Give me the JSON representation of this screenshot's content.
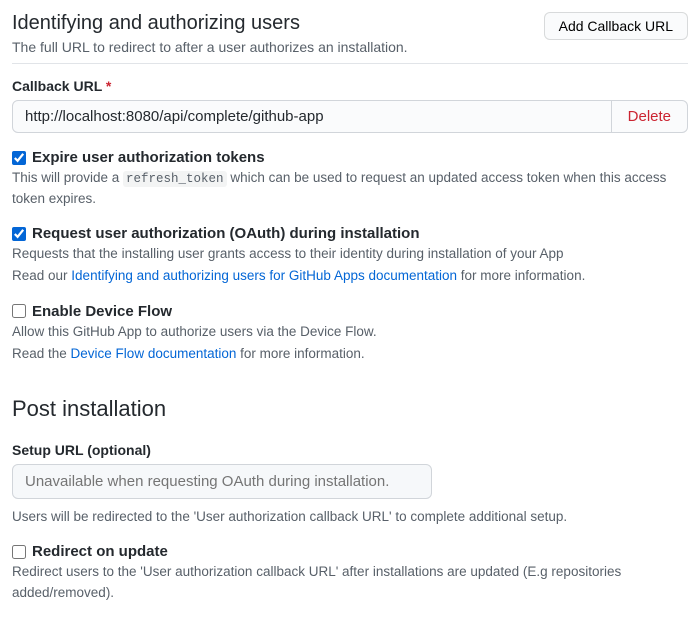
{
  "section1": {
    "title": "Identifying and authorizing users",
    "subtitle": "The full URL to redirect to after a user authorizes an installation.",
    "addBtn": "Add Callback URL"
  },
  "callback": {
    "label": "Callback URL",
    "required": "*",
    "value": "http://localhost:8080/api/complete/github-app",
    "deleteLabel": "Delete"
  },
  "expire": {
    "label": "Expire user authorization tokens",
    "help_pre": "This will provide a ",
    "help_code": "refresh_token",
    "help_post": " which can be used to request an updated access token when this access token expires."
  },
  "oauth": {
    "label": "Request user authorization (OAuth) during installation",
    "help1": "Requests that the installing user grants access to their identity during installation of your App",
    "help2_pre": "Read our ",
    "help2_link": "Identifying and authorizing users for GitHub Apps documentation",
    "help2_post": " for more information."
  },
  "device": {
    "label": "Enable Device Flow",
    "help1": "Allow this GitHub App to authorize users via the Device Flow.",
    "help2_pre": "Read the ",
    "help2_link": "Device Flow documentation",
    "help2_post": " for more information."
  },
  "post": {
    "title": "Post installation"
  },
  "setup": {
    "label": "Setup URL (optional)",
    "placeholder": "Unavailable when requesting OAuth during installation.",
    "help": "Users will be redirected to the 'User authorization callback URL' to complete additional setup."
  },
  "redirect": {
    "label": "Redirect on update",
    "help": "Redirect users to the 'User authorization callback URL' after installations are updated (E.g repositories added/removed)."
  }
}
